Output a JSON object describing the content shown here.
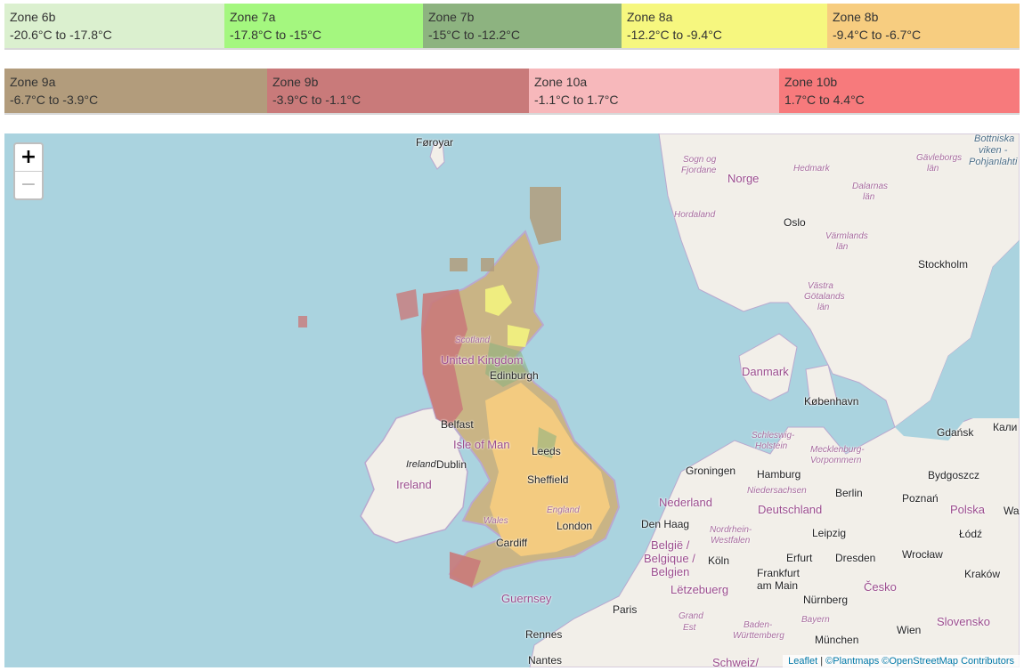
{
  "legend": {
    "row1": [
      {
        "zone": "Zone 6b",
        "range": "-20.6°C to -17.8°C",
        "color": "#dbf0cf"
      },
      {
        "zone": "Zone 7a",
        "range": "-17.8°C to -15°C",
        "color": "#a4f77f"
      },
      {
        "zone": "Zone 7b",
        "range": "-15°C to -12.2°C",
        "color": "#8db380"
      },
      {
        "zone": "Zone 8a",
        "range": "-12.2°C to -9.4°C",
        "color": "#f6f77f"
      },
      {
        "zone": "Zone 8b",
        "range": "-9.4°C to -6.7°C",
        "color": "#f7cd80"
      }
    ],
    "row2": [
      {
        "zone": "Zone 9a",
        "range": "-6.7°C to -3.9°C",
        "color": "#b29c7c"
      },
      {
        "zone": "Zone 9b",
        "range": "-3.9°C to -1.1°C",
        "color": "#c97a7a"
      },
      {
        "zone": "Zone 10a",
        "range": "-1.1°C to 1.7°C",
        "color": "#f7b8bb"
      },
      {
        "zone": "Zone 10b",
        "range": "1.7°C to 4.4°C",
        "color": "#f77a7c"
      }
    ]
  },
  "map": {
    "zoom_in": "+",
    "zoom_out": "−",
    "attribution": {
      "leaflet": "Leaflet",
      "sep": " | ",
      "plantmaps": "©Plantmaps",
      "osm": "©OpenStreetMap Contributors"
    },
    "labels": {
      "foroyar": "Føroyar",
      "norge": "Norge",
      "oslo": "Oslo",
      "stockholm": "Stockholm",
      "danmark": "Danmark",
      "kobenhavn": "København",
      "uk": "United Kingdom",
      "scotland": "Scotland",
      "edinburgh": "Edinburgh",
      "belfast": "Belfast",
      "isle_of_man": "Isle of Man",
      "ireland_it": "Ireland",
      "dublin": "Dublin",
      "ireland": "Ireland",
      "leeds": "Leeds",
      "sheffield": "Sheffield",
      "england": "England",
      "wales": "Wales",
      "cardiff": "Cardiff",
      "london": "London",
      "guernsey": "Guernsey",
      "rennes": "Rennes",
      "nantes": "Nantes",
      "paris": "Paris",
      "groningen": "Groningen",
      "hamburg": "Hamburg",
      "berlin": "Berlin",
      "nederland": "Nederland",
      "deutschland": "Deutschland",
      "den_haag": "Den Haag",
      "belgie": "België /",
      "belgique": "Belgique /",
      "belgien": "Belgien",
      "koln": "Köln",
      "frankfurt1": "Frankfurt",
      "frankfurt2": "am Main",
      "erfurt": "Erfurt",
      "leipzig": "Leipzig",
      "dresden": "Dresden",
      "letzebuerg": "Lëtzebuerg",
      "nurnberg": "Nürnberg",
      "munchen": "München",
      "cesko": "Česko",
      "wien": "Wien",
      "slovensko": "Slovensko",
      "polska": "Polska",
      "gdansk": "Gdańsk",
      "kali": "Кали",
      "bydgoszcz": "Bydgoszcz",
      "poznan": "Poznań",
      "lodz": "Łódź",
      "wroclaw": "Wrocław",
      "krakow": "Kraków",
      "wa": "Wa",
      "bayern": "Bayern",
      "baden1": "Baden-",
      "baden2": "Württemberg",
      "schweiz": "Schweiz/",
      "grand_est1": "Grand",
      "grand_est2": "Est",
      "niedersachsen": "Niedersachsen",
      "nrw1": "Nordrhein-",
      "nrw2": "Westfalen",
      "schleswig1": "Schleswig-",
      "schleswig2": "Holstein",
      "meck1": "Mecklenburg-",
      "meck2": "Vorpommern",
      "sogn1": "Sogn og",
      "sogn2": "Fjordane",
      "hordaland": "Hordaland",
      "hedmark": "Hedmark",
      "dalarnas1": "Dalarnas",
      "dalarnas2": "län",
      "gavle1": "Gävleborgs",
      "gavle2": "län",
      "varmlands1": "Värmlands",
      "varmlands2": "län",
      "vgot1": "Västra",
      "vgot2": "Götalands",
      "vgot3": "län",
      "bott1": "Bottniska",
      "bott2": "viken -",
      "bott3": "Pohjanlahti"
    }
  }
}
